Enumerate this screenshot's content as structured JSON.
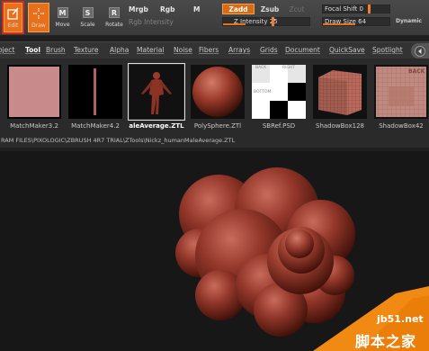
{
  "toolbar": {
    "edit_label": "Edit",
    "draw_label": "Draw",
    "move_label": "Move",
    "scale_label": "Scale",
    "rotate_label": "Rotate",
    "move_icon": "M",
    "scale_icon": "S",
    "rotate_icon": "R",
    "mrgb": "Mrgb",
    "rgb": "Rgb",
    "m": "M",
    "rgb_intensity": "Rgb Intensity",
    "zadd": "Zadd",
    "zsub": "Zsub",
    "zcut": "Zcut",
    "z_intensity_label": "Z Intensity",
    "z_intensity_value": "25",
    "focal_shift_label": "Focal Shift",
    "focal_shift_value": "0",
    "draw_size_label": "Draw Size",
    "draw_size_value": "64",
    "dynamic": "Dynamic",
    "accent_color": "#e8701a"
  },
  "menu": {
    "items": [
      "oject",
      "Tool",
      "Brush",
      "Texture",
      "Alpha",
      "Material",
      "Noise",
      "Fibers",
      "Arrays",
      "Grids",
      "Document",
      "QuickSave",
      "Spotlight"
    ],
    "current": "Tool"
  },
  "palette": {
    "thumbnails": [
      {
        "label": "MatchMaker3.2",
        "icon": "pink-plane-thumbnail"
      },
      {
        "label": "MatchMaker4.2",
        "icon": "black-plane-thumbnail"
      },
      {
        "label": "aleAverage.ZTL",
        "icon": "human-figure-thumbnail",
        "selected": true
      },
      {
        "label": "PolySphere.ZTl",
        "icon": "sphere-thumbnail"
      },
      {
        "label": "SBRef.PSD",
        "icon": "checker-reference-thumbnail"
      },
      {
        "label": "ShadowBox128",
        "icon": "cube-thumbnail"
      },
      {
        "label": "ShadowBox42",
        "icon": "shadowbox-thumbnail"
      }
    ],
    "sbref_back": "BACK",
    "sbref_right": "RIGHT",
    "sbref_bottom": "BOTTOM",
    "shadowbox_back": "BACK",
    "path": "RAM FILES\\PIXOLOGIC\\ZBRUSH 4R7 TRIAL\\ZTools\\Nickz_humanMaleAverage.ZTL"
  },
  "watermark": {
    "url": "jb51.net",
    "text": "脚本之家"
  }
}
